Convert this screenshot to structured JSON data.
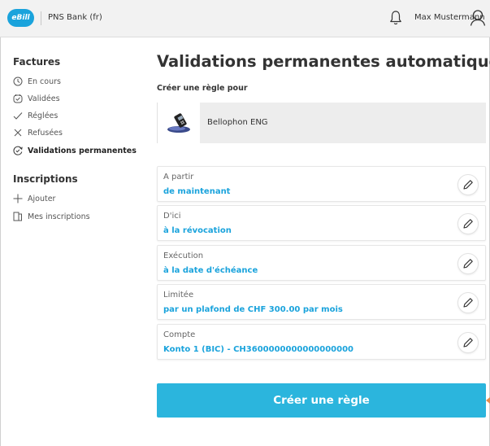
{
  "header": {
    "logo_text": "eBill",
    "bank_name": "PNS Bank (fr)",
    "user_name": "Max Mustermann",
    "bell_icon": "bell-icon",
    "user_icon": "user-icon"
  },
  "sidebar": {
    "sections": [
      {
        "title": "Factures",
        "items": [
          {
            "label": "En cours",
            "icon": "clock-icon"
          },
          {
            "label": "Validées",
            "icon": "calendar-check-icon"
          },
          {
            "label": "Réglées",
            "icon": "check-icon"
          },
          {
            "label": "Refusées",
            "icon": "close-icon"
          },
          {
            "label": "Validations permanentes",
            "icon": "repeat-check-icon",
            "active": true
          }
        ]
      },
      {
        "title": "Inscriptions",
        "items": [
          {
            "label": "Ajouter",
            "icon": "plus-icon"
          },
          {
            "label": "Mes inscriptions",
            "icon": "documents-icon"
          }
        ]
      }
    ]
  },
  "main": {
    "title": "Validations permanentes automatiques",
    "subtitle": "Créer une règle pour",
    "biller": {
      "name": "Bellophon ENG"
    },
    "fields": [
      {
        "label": "A partir",
        "value": "de maintenant"
      },
      {
        "label": "D'ici",
        "value": "à la révocation"
      },
      {
        "label": "Exécution",
        "value": "à la date d'échéance"
      },
      {
        "label": "Limitée",
        "value": "par un plafond de CHF 300.00 par mois"
      },
      {
        "label": "Compte",
        "value": "Konto 1 (BIC) - CH3600000000000000000"
      }
    ],
    "submit_label": "Créer une règle"
  },
  "colors": {
    "accent": "#1aa3dc",
    "button": "#2bb5dd",
    "header_bg": "#f2f2f2"
  }
}
